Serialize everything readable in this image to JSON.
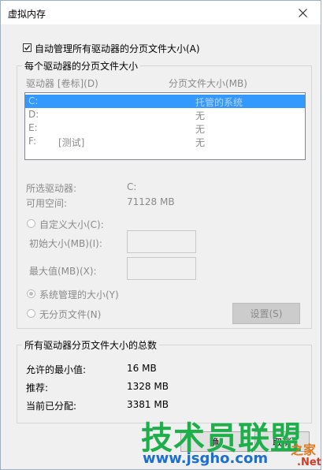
{
  "window": {
    "title": "虚拟内存"
  },
  "auto_manage": {
    "label": "自动管理所有驱动器的分页文件大小(A)",
    "checked": true
  },
  "per_drive": {
    "legend": "每个驱动器的分页文件大小",
    "col_drive": "驱动器 [卷标](D)",
    "col_size": "分页文件大小(MB)",
    "drives": [
      {
        "drive": "C:",
        "label": "",
        "size": "托管的系统",
        "selected": true
      },
      {
        "drive": "D:",
        "label": "",
        "size": "无",
        "selected": false
      },
      {
        "drive": "E:",
        "label": "",
        "size": "无",
        "selected": false
      },
      {
        "drive": "F:",
        "label": "[测试]",
        "size": "无",
        "selected": false
      }
    ],
    "selected_drive_label": "所选驱动器:",
    "selected_drive_value": "C:",
    "free_space_label": "可用空间:",
    "free_space_value": "71128 MB",
    "custom_size_label": "自定义大小(C):",
    "initial_size_label": "初始大小(MB)(I):",
    "max_size_label": "最大值(MB)(X):",
    "system_managed_label": "系统管理的大小(Y)",
    "no_paging_label": "无分页文件(N)",
    "set_button": "设置(S)"
  },
  "totals": {
    "legend": "所有驱动器分页文件大小的总数",
    "min_label": "允许的最小值:",
    "min_value": "16 MB",
    "recommended_label": "推荐:",
    "recommended_value": "1328 MB",
    "allocated_label": "当前已分配:",
    "allocated_value": "3381 MB"
  },
  "buttons": {
    "ok_partial": "确",
    "cancel_partial": "取消"
  },
  "watermark": {
    "brand": "技术员联盟",
    "url": "www.jsgho.com",
    "side_top": "之家",
    "side_bottom": ".Net"
  }
}
